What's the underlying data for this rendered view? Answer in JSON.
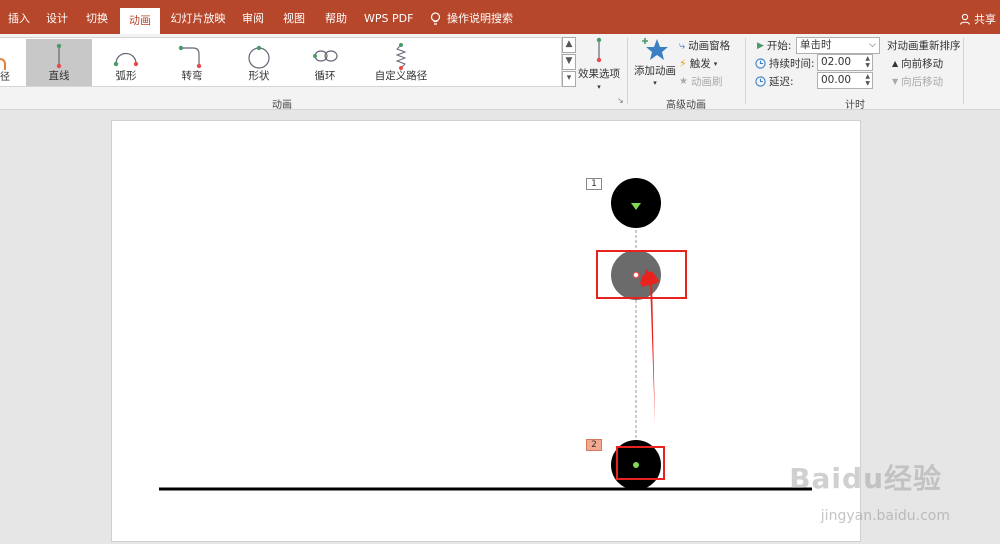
{
  "tabs": [
    {
      "label": "插入"
    },
    {
      "label": "设计"
    },
    {
      "label": "切换"
    },
    {
      "label": "动画"
    },
    {
      "label": "幻灯片放映"
    },
    {
      "label": "审阅"
    },
    {
      "label": "视图"
    },
    {
      "label": "帮助"
    },
    {
      "label": "WPS PDF"
    },
    {
      "label": "操作说明搜索"
    }
  ],
  "share_label": "共享",
  "gallery": {
    "items": [
      {
        "label": "直线",
        "icon": "line-path-icon",
        "selected": true
      },
      {
        "label": "弧形",
        "icon": "arc-path-icon"
      },
      {
        "label": "转弯",
        "icon": "turn-path-icon"
      },
      {
        "label": "形状",
        "icon": "shape-path-icon"
      },
      {
        "label": "循环",
        "icon": "loop-path-icon"
      },
      {
        "label": "自定义路径",
        "icon": "custom-path-icon"
      }
    ],
    "effect_options_label": "效果选项",
    "group_label": "动画"
  },
  "advanced": {
    "add_animation_label": "添加动画",
    "animation_pane_label": "动画窗格",
    "trigger_label": "触发",
    "painter_label": "动画刷",
    "group_label": "高级动画"
  },
  "timing": {
    "start_label": "开始:",
    "start_value": "单击时",
    "duration_label": "持续时间:",
    "duration_value": "02.00",
    "delay_label": "延迟:",
    "delay_value": "00.00",
    "group_label": "计时",
    "reorder_title": "对动画重新排序",
    "move_earlier_label": "向前移动",
    "move_later_label": "向后移动"
  },
  "slide": {
    "tag1": "1",
    "tag2": "2"
  },
  "watermark": {
    "brand": "Baidu经验",
    "url": "jingyan.baidu.com"
  },
  "colors": {
    "ribbon_accent": "#b7472a",
    "highlight_red": "#e8231d",
    "start_marker": "#7ed957",
    "end_marker": "#e84a4a"
  }
}
